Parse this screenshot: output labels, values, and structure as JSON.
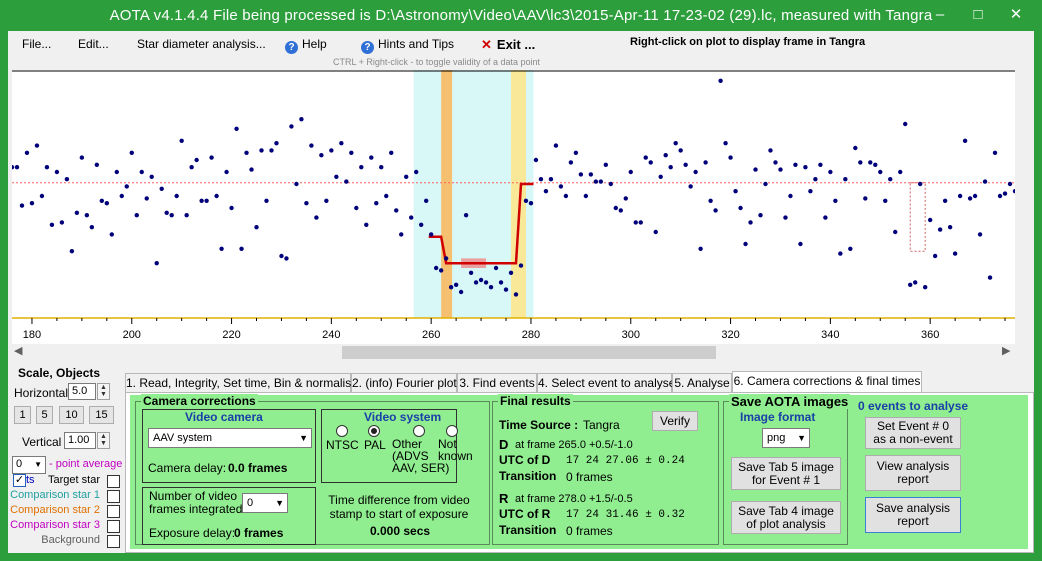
{
  "window": {
    "title": "AOTA v4.1.4.4    File being processed is D:\\Astronomy\\Video\\AAV\\lc3\\2015-Apr-11 17-23-02 (29).lc, measured with Tangra",
    "minimize": "–",
    "maximize": "□",
    "close": "✕"
  },
  "menu": {
    "file": "File...",
    "edit": "Edit...",
    "star_diameter": "Star diameter analysis...",
    "help": "Help",
    "hints": "Hints and Tips",
    "exit": "Exit ...",
    "right_click_hint": "Right-click on plot to display frame in Tangra",
    "ctrl_hint": "CTRL + Right-click  -  to toggle validity of a data point"
  },
  "plot": {
    "x_ticks": [
      "180",
      "200",
      "220",
      "240",
      "260",
      "280",
      "300",
      "320",
      "340",
      "360"
    ],
    "x_range": [
      176,
      377
    ],
    "y_range": [
      0,
      1
    ],
    "baseline_level": 0.555,
    "event_level": 0.22,
    "colors": {
      "points": "#00007a",
      "model": "#d00000",
      "baseline": "#ff6060",
      "d_band": "#f5c070",
      "r_band": "#f8e898",
      "window": "#d8f8f8"
    },
    "points": [
      [
        176,
        0.62
      ],
      [
        177,
        0.62
      ],
      [
        178,
        0.46
      ],
      [
        179,
        0.68
      ],
      [
        180,
        0.47
      ],
      [
        181,
        0.71
      ],
      [
        182,
        0.5
      ],
      [
        183,
        0.62
      ],
      [
        184,
        0.38
      ],
      [
        185,
        0.6
      ],
      [
        186,
        0.39
      ],
      [
        187,
        0.57
      ],
      [
        188,
        0.27
      ],
      [
        189,
        0.43
      ],
      [
        190,
        0.66
      ],
      [
        191,
        0.42
      ],
      [
        192,
        0.37
      ],
      [
        193,
        0.63
      ],
      [
        194,
        0.48
      ],
      [
        195,
        0.47
      ],
      [
        196,
        0.34
      ],
      [
        197,
        0.6
      ],
      [
        198,
        0.5
      ],
      [
        199,
        0.54
      ],
      [
        200,
        0.68
      ],
      [
        201,
        0.42
      ],
      [
        202,
        0.6
      ],
      [
        203,
        0.49
      ],
      [
        204,
        0.58
      ],
      [
        205,
        0.22
      ],
      [
        206,
        0.53
      ],
      [
        207,
        0.43
      ],
      [
        208,
        0.42
      ],
      [
        209,
        0.5
      ],
      [
        210,
        0.73
      ],
      [
        211,
        0.42
      ],
      [
        212,
        0.62
      ],
      [
        213,
        0.65
      ],
      [
        214,
        0.48
      ],
      [
        215,
        0.48
      ],
      [
        216,
        0.66
      ],
      [
        217,
        0.5
      ],
      [
        218,
        0.28
      ],
      [
        219,
        0.6
      ],
      [
        220,
        0.45
      ],
      [
        221,
        0.78
      ],
      [
        222,
        0.28
      ],
      [
        223,
        0.68
      ],
      [
        224,
        0.61
      ],
      [
        225,
        0.37
      ],
      [
        226,
        0.69
      ],
      [
        227,
        0.48
      ],
      [
        228,
        0.69
      ],
      [
        229,
        0.72
      ],
      [
        230,
        0.25
      ],
      [
        231,
        0.24
      ],
      [
        232,
        0.79
      ],
      [
        233,
        0.55
      ],
      [
        234,
        0.82
      ],
      [
        235,
        0.47
      ],
      [
        236,
        0.71
      ],
      [
        237,
        0.41
      ],
      [
        238,
        0.67
      ],
      [
        239,
        0.48
      ],
      [
        240,
        0.69
      ],
      [
        241,
        0.58
      ],
      [
        242,
        0.72
      ],
      [
        243,
        0.56
      ],
      [
        244,
        0.68
      ],
      [
        245,
        0.45
      ],
      [
        246,
        0.62
      ],
      [
        247,
        0.38
      ],
      [
        248,
        0.66
      ],
      [
        249,
        0.47
      ],
      [
        250,
        0.62
      ],
      [
        251,
        0.5
      ],
      [
        252,
        0.68
      ],
      [
        253,
        0.44
      ],
      [
        254,
        0.34
      ],
      [
        255,
        0.58
      ],
      [
        256,
        0.41
      ],
      [
        257,
        0.6
      ],
      [
        258,
        0.38
      ],
      [
        259,
        0.48
      ],
      [
        260,
        0.34
      ],
      [
        261,
        0.2
      ],
      [
        262,
        0.19
      ],
      [
        263,
        0.24
      ],
      [
        264,
        0.12
      ],
      [
        265,
        0.13
      ],
      [
        266,
        0.1
      ],
      [
        267,
        0.42
      ],
      [
        268,
        0.18
      ],
      [
        269,
        0.14
      ],
      [
        270,
        0.15
      ],
      [
        271,
        0.14
      ],
      [
        272,
        0.12
      ],
      [
        273,
        0.2
      ],
      [
        274,
        0.14
      ],
      [
        275,
        0.11
      ],
      [
        276,
        0.18
      ],
      [
        277,
        0.09
      ],
      [
        278,
        0.21
      ],
      [
        279,
        0.48
      ],
      [
        280,
        0.47
      ],
      [
        281,
        0.65
      ],
      [
        282,
        0.57
      ],
      [
        283,
        0.52
      ],
      [
        284,
        0.57
      ],
      [
        285,
        0.71
      ],
      [
        286,
        0.54
      ],
      [
        287,
        0.5
      ],
      [
        288,
        0.64
      ],
      [
        289,
        0.68
      ],
      [
        290,
        0.59
      ],
      [
        291,
        0.5
      ],
      [
        292,
        0.59
      ],
      [
        293,
        0.56
      ],
      [
        294,
        0.56
      ],
      [
        295,
        0.63
      ],
      [
        296,
        0.55
      ],
      [
        297,
        0.45
      ],
      [
        298,
        0.44
      ],
      [
        299,
        0.49
      ],
      [
        300,
        0.6
      ],
      [
        301,
        0.39
      ],
      [
        302,
        0.39
      ],
      [
        303,
        0.66
      ],
      [
        304,
        0.64
      ],
      [
        305,
        0.35
      ],
      [
        306,
        0.58
      ],
      [
        307,
        0.67
      ],
      [
        308,
        0.62
      ],
      [
        309,
        0.72
      ],
      [
        310,
        0.69
      ],
      [
        311,
        0.63
      ],
      [
        312,
        0.54
      ],
      [
        313,
        0.6
      ],
      [
        314,
        0.28
      ],
      [
        315,
        0.64
      ],
      [
        316,
        0.48
      ],
      [
        317,
        0.44
      ],
      [
        318,
        0.98
      ],
      [
        319,
        0.72
      ],
      [
        320,
        0.66
      ],
      [
        321,
        0.52
      ],
      [
        322,
        0.45
      ],
      [
        323,
        0.3
      ],
      [
        324,
        0.39
      ],
      [
        325,
        0.61
      ],
      [
        326,
        0.42
      ],
      [
        327,
        0.55
      ],
      [
        328,
        0.69
      ],
      [
        329,
        0.64
      ],
      [
        330,
        0.61
      ],
      [
        331,
        0.41
      ],
      [
        332,
        0.5
      ],
      [
        333,
        0.63
      ],
      [
        334,
        0.3
      ],
      [
        335,
        0.62
      ],
      [
        336,
        0.52
      ],
      [
        337,
        0.57
      ],
      [
        338,
        0.63
      ],
      [
        339,
        0.41
      ],
      [
        340,
        0.6
      ],
      [
        341,
        0.48
      ],
      [
        342,
        0.26
      ],
      [
        343,
        0.57
      ],
      [
        344,
        0.28
      ],
      [
        345,
        0.7
      ],
      [
        346,
        0.64
      ],
      [
        347,
        0.49
      ],
      [
        348,
        0.64
      ],
      [
        349,
        0.63
      ],
      [
        350,
        0.6
      ],
      [
        351,
        0.48
      ],
      [
        352,
        0.57
      ],
      [
        353,
        0.35
      ],
      [
        354,
        0.6
      ],
      [
        355,
        0.8
      ],
      [
        356,
        0.13
      ],
      [
        357,
        0.14
      ],
      [
        358,
        0.55
      ],
      [
        359,
        0.12
      ],
      [
        360,
        0.4
      ],
      [
        361,
        0.25
      ],
      [
        362,
        0.36
      ],
      [
        363,
        0.48
      ],
      [
        364,
        0.37
      ],
      [
        365,
        0.26
      ],
      [
        366,
        0.5
      ],
      [
        367,
        0.73
      ],
      [
        368,
        0.49
      ],
      [
        369,
        0.5
      ],
      [
        370,
        0.34
      ],
      [
        371,
        0.56
      ],
      [
        372,
        0.16
      ],
      [
        373,
        0.68
      ],
      [
        374,
        0.5
      ],
      [
        375,
        0.51
      ],
      [
        376,
        0.55
      ],
      [
        377,
        0.52
      ]
    ]
  },
  "left_panel": {
    "title": "Scale,  Objects",
    "horizontal_label": "Horizontal",
    "horizontal_value": "5.0",
    "zoom_buttons": [
      "1",
      "5",
      "10",
      "15"
    ],
    "vertical_label": "Vertical",
    "vertical_value": "1.00",
    "point_avg_value": "0",
    "point_avg_label": "- point average",
    "objects": [
      {
        "label": "Target star",
        "checked": true,
        "color": "#0000c0"
      },
      {
        "label": "Comparison star 1",
        "checked": false,
        "color": "#20a0a0"
      },
      {
        "label": "Comparison star 2",
        "checked": false,
        "color": "#e07000"
      },
      {
        "label": "Comparison star 3",
        "checked": false,
        "color": "#c000c0"
      },
      {
        "label": "Background",
        "checked": false,
        "color": "#606060"
      }
    ],
    "partial_label": "ts"
  },
  "tabs": [
    "1. Read, Integrity, Set time, Bin & normalise",
    "2. (info)  Fourier plot",
    "3. Find events",
    "4. Select event to analyse",
    "5. Analyse",
    "6. Camera corrections & final times"
  ],
  "camera": {
    "title": "Camera corrections",
    "video_camera_title": "Video camera",
    "camera_value": "AAV system",
    "camera_delay_label": "Camera delay:",
    "camera_delay_value": "0.0 frames",
    "video_system_title": "Video system",
    "ntsc": "NTSC",
    "pal": "PAL",
    "other": "Other\n(ADVS\nAAV, SER)",
    "not_known": "Not\nknown",
    "frames_integrated_label": "Number of video frames integrated",
    "frames_integrated_value": "0",
    "exposure_delay_label": "Exposure delay:",
    "exposure_delay_value": "0 frames",
    "time_diff_label": "Time difference from video stamp to start of exposure",
    "time_diff_value": "0.000 secs"
  },
  "final": {
    "title": "Final results",
    "time_source_label": "Time Source :",
    "time_source_value": "Tangra",
    "verify": "Verify",
    "d_label": "D",
    "d_frame": "at frame 265.0  +0.5/-1.0",
    "utc_d_label": "UTC of D",
    "utc_d_value": "17 24 27.06  ± 0.24",
    "transition_label": "Transition",
    "transition_d_value": "0 frames",
    "r_label": "R",
    "r_frame": "at frame 278.0  +1.5/-0.5",
    "utc_r_label": "UTC of R",
    "utc_r_value": "17 24 31.46  ± 0.32",
    "transition_r_value": "0 frames"
  },
  "save": {
    "title": "Save AOTA images",
    "format_label": "Image format",
    "format_value": "png",
    "save_tab5": "Save Tab 5 image for Event # 1",
    "save_tab4": "Save Tab 4 image of plot analysis"
  },
  "events": {
    "title": "0  events to analyse",
    "set_event": "Set Event # 0 as a non-event",
    "view_report": "View analysis report",
    "save_report": "Save analysis report"
  }
}
